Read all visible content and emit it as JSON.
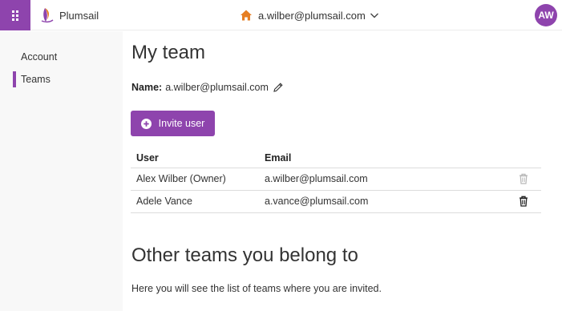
{
  "header": {
    "brand_name": "Plumsail",
    "account_email": "a.wilber@plumsail.com",
    "avatar_initials": "AW",
    "brand_color": "#8e44ad",
    "home_icon_color": "#e67e22"
  },
  "sidebar": {
    "items": [
      {
        "label": "Account",
        "active": false
      },
      {
        "label": "Teams",
        "active": true
      }
    ]
  },
  "main": {
    "title": "My team",
    "name_label": "Name:",
    "name_value": "a.wilber@plumsail.com",
    "invite_button_label": "Invite user",
    "table": {
      "headers": [
        "User",
        "Email"
      ],
      "rows": [
        {
          "user": "Alex Wilber (Owner)",
          "email": "a.wilber@plumsail.com",
          "delete_enabled": false
        },
        {
          "user": "Adele Vance",
          "email": "a.vance@plumsail.com",
          "delete_enabled": true
        }
      ]
    },
    "other_teams_title": "Other teams you belong to",
    "other_teams_desc": "Here you will see the list of teams where you are invited."
  },
  "icons": [
    "waffle-icon",
    "plumsail-logo",
    "home-icon",
    "chevron-down-icon",
    "pencil-icon",
    "plus-circle-icon",
    "trash-icon"
  ]
}
